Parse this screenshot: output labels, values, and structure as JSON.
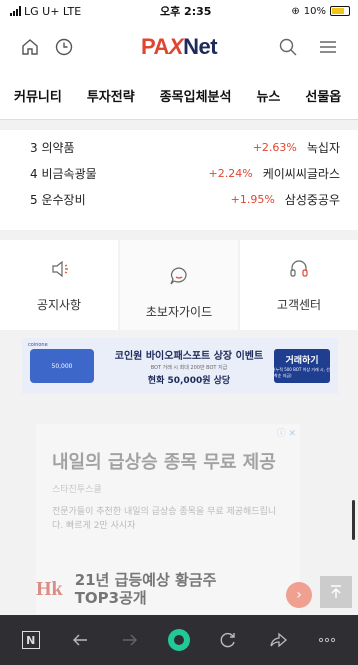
{
  "status": {
    "carrier": "LG U+",
    "network": "LTE",
    "time": "오후 2:35",
    "battery": "10%"
  },
  "header": {
    "logo_pa": "PA",
    "logo_x": "X",
    "logo_net": "Net"
  },
  "nav": {
    "tabs": [
      "커뮤니티",
      "투자전략",
      "종목입체분석",
      "뉴스",
      "선물옵"
    ]
  },
  "ranking": [
    {
      "rank": "3",
      "sector": "의약품",
      "change": "+2.63%",
      "stock": "녹십자"
    },
    {
      "rank": "4",
      "sector": "비금속광물",
      "change": "+2.24%",
      "stock": "케이씨씨글라스"
    },
    {
      "rank": "5",
      "sector": "운수장비",
      "change": "+1.95%",
      "stock": "삼성중공우"
    }
  ],
  "menu": {
    "notice": "공지사항",
    "guide": "초보자가이드",
    "support": "고객센터"
  },
  "banner": {
    "brand": "coinone",
    "coin_amount": "50,000",
    "headline": "코인원 바이오패스포트 상장 이벤트",
    "subline": "BOT 거래 시 최대 200만 BOT 지급",
    "offer": "현화 50,000원 상당",
    "cta": "거래하기",
    "cta_small": "(누적 500 BOT 이상 거래 시, 선착순 지급)"
  },
  "ad": {
    "badge": "ⓘ ✕",
    "title": "내일의 급상승 종목 무료 제공",
    "source": "스타진투스클",
    "desc": "전문가들이 추천한 내일의 급상승 종목을 무료 제공해드립니다. 빠르게 2만 사시자"
  },
  "overlay_ad": {
    "logo": "Hk",
    "text_line1": "21년 급등예상 황금주",
    "text_line2": "TOP3공개"
  },
  "colors": {
    "brand_red": "#e0452f",
    "brand_navy": "#1d2a5a",
    "rise": "#e0452f",
    "toolbar": "#2f2f33",
    "home_green": "#20c997"
  }
}
